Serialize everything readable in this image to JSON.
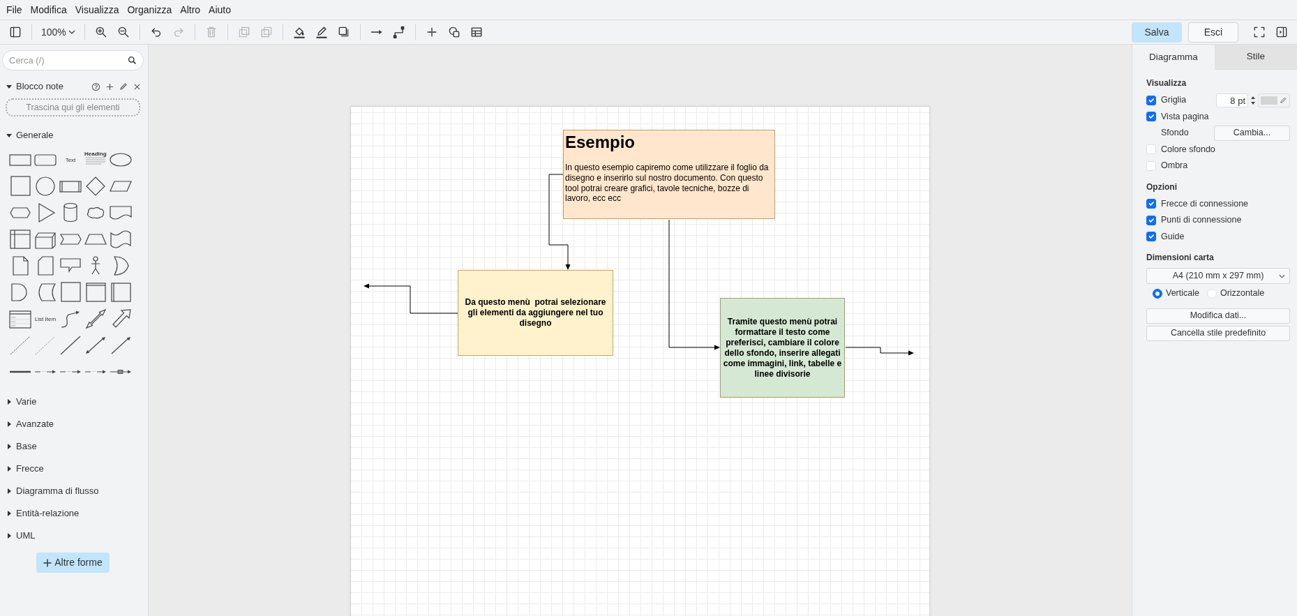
{
  "menu": [
    "File",
    "Modifica",
    "Visualizza",
    "Organizza",
    "Altro",
    "Aiuto"
  ],
  "toolbar": {
    "groups": [
      [
        {
          "kind": "sidebar-toggle",
          "disabled": false
        }
      ],
      [
        {
          "kind": "zoom",
          "label": "100%",
          "disabled": false
        }
      ],
      [
        {
          "kind": "zoom-in",
          "disabled": false
        },
        {
          "kind": "zoom-out",
          "disabled": false
        }
      ],
      [
        {
          "kind": "undo",
          "disabled": false
        },
        {
          "kind": "redo",
          "disabled": true
        }
      ],
      [
        {
          "kind": "delete",
          "disabled": true
        }
      ],
      [
        {
          "kind": "to-front",
          "disabled": true
        },
        {
          "kind": "to-back",
          "disabled": true
        }
      ],
      [
        {
          "kind": "fill",
          "disabled": false
        },
        {
          "kind": "line-color",
          "disabled": false
        },
        {
          "kind": "shadow",
          "disabled": false
        }
      ],
      [
        {
          "kind": "connection",
          "disabled": false
        },
        {
          "kind": "waypoints",
          "disabled": false
        }
      ],
      [
        {
          "kind": "insert",
          "disabled": false
        },
        {
          "kind": "shapes",
          "disabled": false
        },
        {
          "kind": "table",
          "disabled": false
        }
      ]
    ],
    "save": "Salva",
    "exit": "Esci"
  },
  "sidebar": {
    "search": {
      "placeholder": "Cerca (/)"
    },
    "scratchpad": {
      "title": "Blocco note",
      "expanded": true,
      "hint": "Trascina qui gli elementi"
    },
    "general": {
      "title": "Generale",
      "expanded": true,
      "shapes": [
        {
          "kind": "rectangle"
        },
        {
          "kind": "rounded"
        },
        {
          "kind": "text",
          "label": "Text"
        },
        {
          "kind": "heading",
          "label": "Heading"
        },
        {
          "kind": "ellipse"
        },
        {
          "kind": "square"
        },
        {
          "kind": "circle"
        },
        {
          "kind": "process"
        },
        {
          "kind": "diamond"
        },
        {
          "kind": "parallelogram"
        },
        {
          "kind": "hexagon"
        },
        {
          "kind": "triangle"
        },
        {
          "kind": "cylinder"
        },
        {
          "kind": "cloud"
        },
        {
          "kind": "document"
        },
        {
          "kind": "internal-storage"
        },
        {
          "kind": "cube"
        },
        {
          "kind": "step"
        },
        {
          "kind": "trapezoid"
        },
        {
          "kind": "tape"
        },
        {
          "kind": "note"
        },
        {
          "kind": "card"
        },
        {
          "kind": "callout"
        },
        {
          "kind": "actor"
        },
        {
          "kind": "or"
        },
        {
          "kind": "delay"
        },
        {
          "kind": "data-storage"
        },
        {
          "kind": "square"
        },
        {
          "kind": "container"
        },
        {
          "kind": "swimlane"
        },
        {
          "kind": "list"
        },
        {
          "kind": "list-item",
          "label": "List Item"
        },
        {
          "kind": "curved-arrow"
        },
        {
          "kind": "double-arrow"
        },
        {
          "kind": "block-arrow"
        },
        {
          "kind": "dashed-line"
        },
        {
          "kind": "dotted-line"
        },
        {
          "kind": "line"
        },
        {
          "kind": "bidirectional"
        },
        {
          "kind": "directional"
        },
        {
          "kind": "thick-line"
        },
        {
          "kind": "labeled-connector"
        },
        {
          "kind": "labeled-connector"
        },
        {
          "kind": "labeled-connector"
        },
        {
          "kind": "symbol-connector"
        }
      ]
    },
    "sections": [
      {
        "title": "Varie",
        "expanded": false
      },
      {
        "title": "Avanzate",
        "expanded": false
      },
      {
        "title": "Base",
        "expanded": false
      },
      {
        "title": "Frecce",
        "expanded": false
      },
      {
        "title": "Diagramma di flusso",
        "expanded": false
      },
      {
        "title": "Entità-relazione",
        "expanded": false
      },
      {
        "title": "UML",
        "expanded": false
      }
    ],
    "more_shapes": "Altre forme"
  },
  "canvas": {
    "nodes": [
      {
        "kind": "heading",
        "title": "Esempio",
        "text": "In questo esempio capiremo come utilizzare il foglio da disegno e inserirlo sul nostro documento. Con questo tool potrai creare grafici, tavole tecniche, bozze di lavoro, ecc ecc",
        "color": "#ffe6cc"
      },
      {
        "kind": "label",
        "text": "Da questo menù  potrai selezionare gli elementi da aggiungere nel tuo disegno",
        "color": "#fff2cc"
      },
      {
        "kind": "label",
        "text": "Tramite questo menù potrai formattare il testo come preferisci, cambiare il colore dello sfondo, inserire allegati come immagini, link, tabelle e linee divisorie",
        "color": "#d5e8d4"
      }
    ]
  },
  "format_panel": {
    "tabs": [
      {
        "label": "Diagramma",
        "selected": true
      },
      {
        "label": "Stile",
        "selected": false
      }
    ],
    "sections": [
      {
        "title": "Visualizza",
        "items": [
          {
            "kind": "checkbox",
            "label": "Griglia",
            "checked": true,
            "value": "8 pt"
          },
          {
            "kind": "checkbox",
            "label": "Vista pagina",
            "checked": true
          },
          {
            "kind": "background",
            "label": "Sfondo",
            "button": "Cambia..."
          },
          {
            "kind": "checkbox",
            "label": "Colore sfondo",
            "checked": false
          },
          {
            "kind": "checkbox",
            "label": "Ombra",
            "checked": false
          }
        ]
      },
      {
        "title": "Opzioni",
        "items": [
          {
            "kind": "checkbox",
            "label": "Frecce di connessione",
            "checked": true
          },
          {
            "kind": "checkbox",
            "label": "Punti di connessione",
            "checked": true
          },
          {
            "kind": "checkbox",
            "label": "Guide",
            "checked": true
          }
        ]
      },
      {
        "title": "Dimensioni carta",
        "items": [
          {
            "kind": "select",
            "value": "A4 (210 mm x 297 mm)"
          },
          {
            "kind": "radios",
            "options": [
              {
                "label": "Verticale",
                "selected": true
              },
              {
                "label": "Orizzontale",
                "selected": false
              }
            ]
          }
        ]
      }
    ],
    "buttons": [
      "Modifica dati...",
      "Cancella stile predefinito"
    ]
  }
}
